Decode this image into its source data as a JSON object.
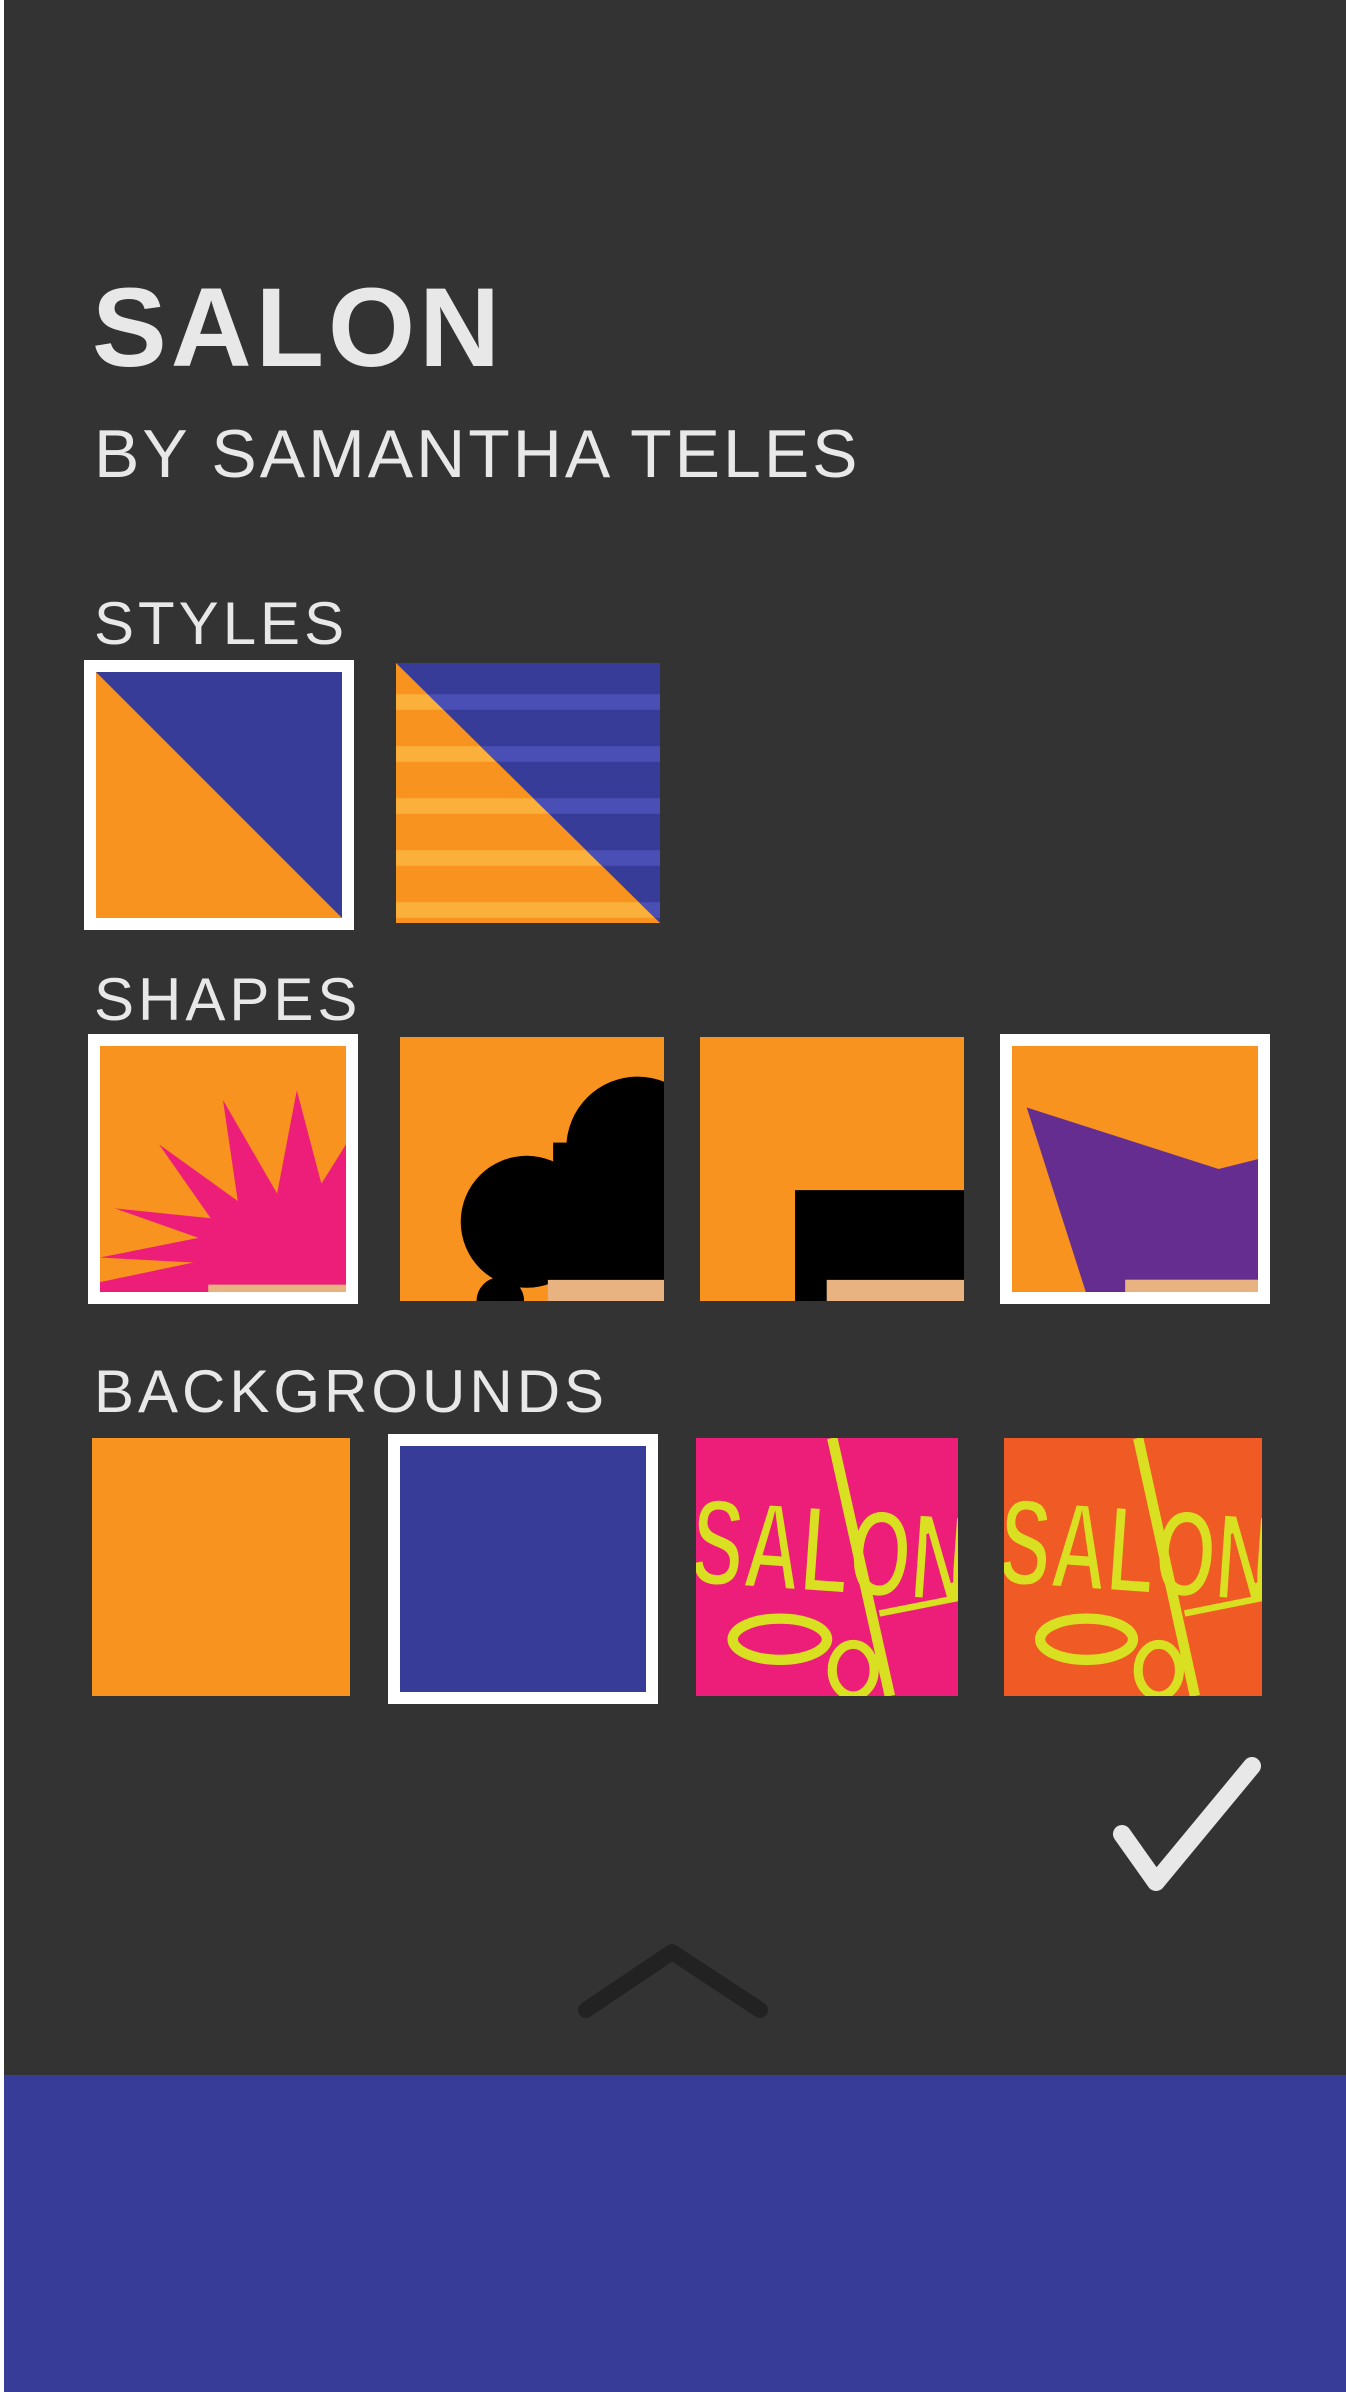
{
  "header": {
    "title": "SALON",
    "subtitle": "BY SAMANTHA TELES"
  },
  "sections": {
    "styles": {
      "label": "STYLES",
      "items": [
        {
          "name": "diagonal-solid",
          "selected": true
        },
        {
          "name": "diagonal-striped",
          "selected": false
        }
      ]
    },
    "shapes": {
      "label": "SHAPES",
      "items": [
        {
          "name": "starburst",
          "selected": true
        },
        {
          "name": "curly-hair",
          "selected": false
        },
        {
          "name": "block-hair",
          "selected": false
        },
        {
          "name": "angled-hair",
          "selected": true
        }
      ]
    },
    "backgrounds": {
      "label": "BACKGROUNDS",
      "items": [
        {
          "name": "orange",
          "selected": false
        },
        {
          "name": "blue",
          "selected": true
        },
        {
          "name": "salon-pink",
          "text": "SALON",
          "selected": false
        },
        {
          "name": "salon-orange",
          "text": "SALON",
          "selected": false
        }
      ]
    }
  },
  "icons": {
    "confirm": "checkmark-icon",
    "expand": "chevron-up-icon"
  },
  "colors": {
    "panel": "#333333",
    "text": "#e8e8e8",
    "orange": "#f7931e",
    "blue": "#383c99",
    "pink": "#ec1e79",
    "purple": "#662d91",
    "red_orange": "#f05a24",
    "yellow": "#d9e021",
    "skin": "#e8b381"
  }
}
